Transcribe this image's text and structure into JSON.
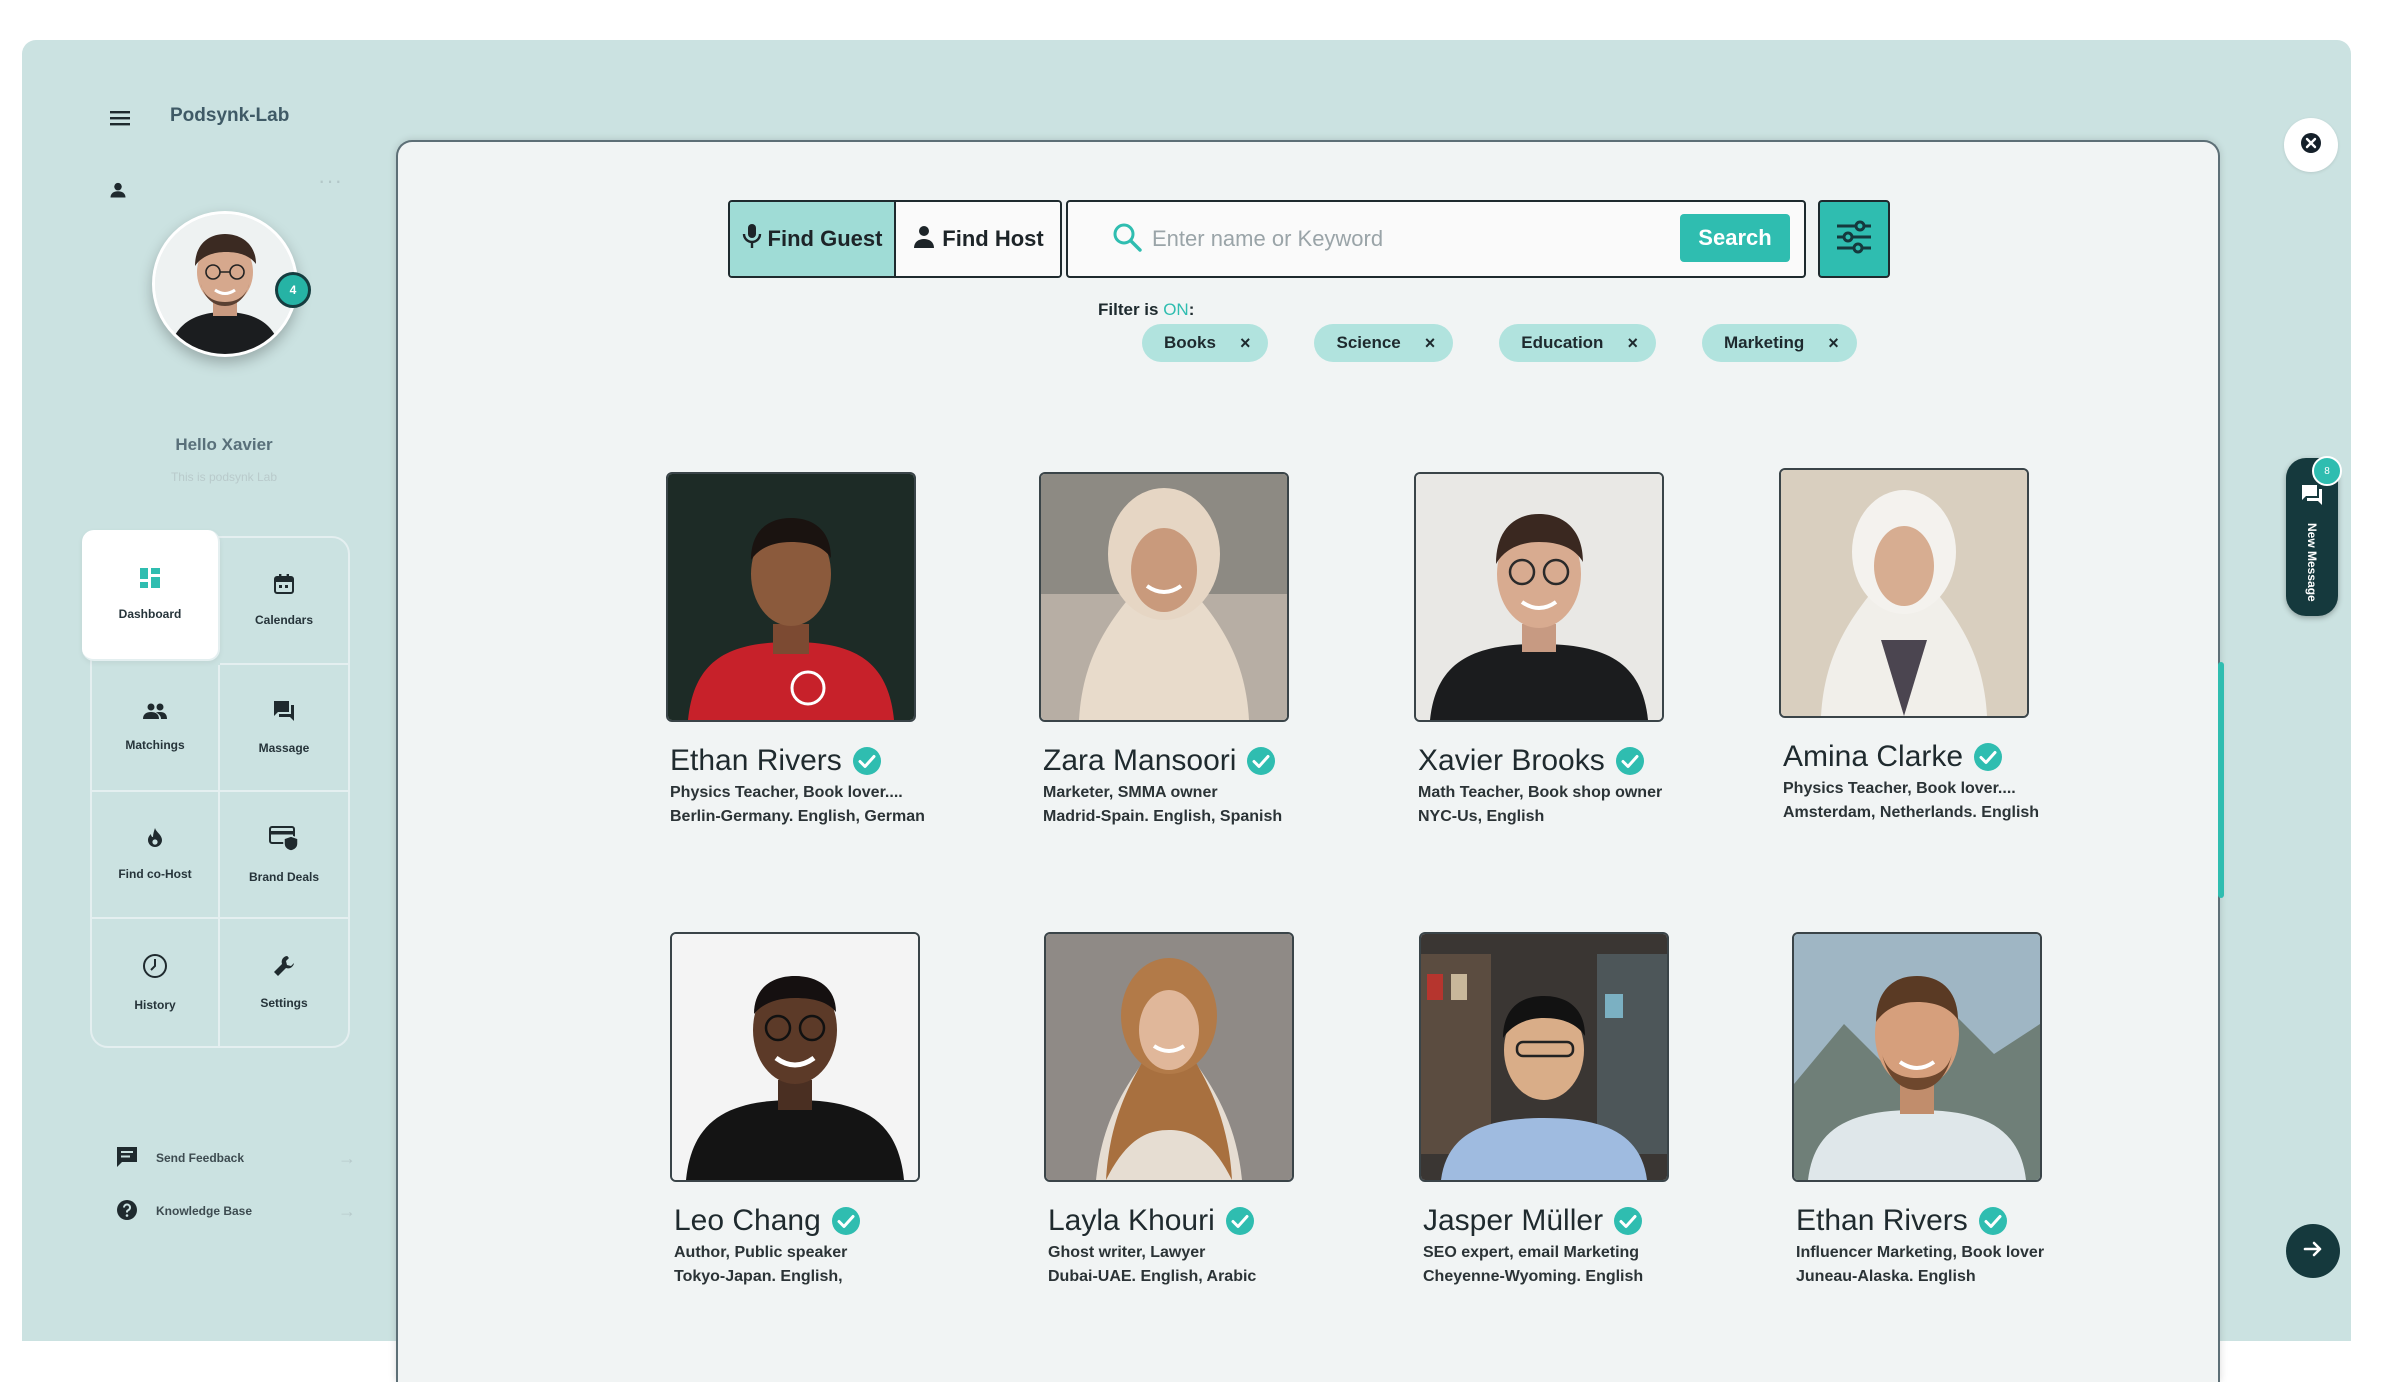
{
  "app": {
    "title": "Podsynk-Lab"
  },
  "profile": {
    "greeting": "Hello Xavier",
    "subtitle": "This is podsynk Lab",
    "badge": "4",
    "menu_dots": "···"
  },
  "nav": [
    {
      "label": "Dashboard",
      "icon": "dashboard-icon",
      "active": true
    },
    {
      "label": "Calendars",
      "icon": "calendar-icon"
    },
    {
      "label": "Matchings",
      "icon": "people-icon"
    },
    {
      "label": "Massage",
      "icon": "chat-icon"
    },
    {
      "label": "Find co-Host",
      "icon": "flame-icon"
    },
    {
      "label": "Brand Deals",
      "icon": "card-shield-icon"
    },
    {
      "label": "History",
      "icon": "clock-icon"
    },
    {
      "label": "Settings",
      "icon": "wrench-icon"
    }
  ],
  "footer": {
    "feedback": "Send Feedback",
    "knowledge": "Knowledge  Base",
    "arrow": "→"
  },
  "search": {
    "find_guest": "Find Guest",
    "find_host": "Find Host",
    "placeholder": "Enter name or Keyword",
    "button": "Search"
  },
  "filter": {
    "label": "Filter is",
    "state": "ON",
    "colon": ":",
    "chips": [
      "Books",
      "Science",
      "Education",
      "Marketing"
    ],
    "remove": "×"
  },
  "guests": [
    {
      "name": "Ethan Rivers",
      "line1": "Physics Teacher, Book lover....",
      "line2": "Berlin-Germany. English, German"
    },
    {
      "name": "Zara Mansoori",
      "line1": "Marketer, SMMA owner",
      "line2": "Madrid-Spain. English, Spanish"
    },
    {
      "name": "Xavier Brooks",
      "line1": "Math Teacher, Book shop owner",
      "line2": "NYC-Us, English"
    },
    {
      "name": "Amina Clarke",
      "line1": "Physics Teacher, Book lover....",
      "line2": " Amsterdam, Netherlands. English"
    },
    {
      "name": "Leo Chang",
      "line1": "Author, Public speaker",
      "line2": "Tokyo-Japan. English,"
    },
    {
      "name": "Layla Khouri",
      "line1": "Ghost writer, Lawyer",
      "line2": "Dubai-UAE. English, Arabic"
    },
    {
      "name": "Jasper Müller",
      "line1": "SEO expert, email Marketing",
      "line2": "Cheyenne-Wyoming. English"
    },
    {
      "name": "Ethan Rivers",
      "line1": "Influencer Marketing, Book lover",
      "line2": "Juneau-Alaska. English"
    }
  ],
  "messages": {
    "label": "New Message",
    "badge": "8"
  },
  "colors": {
    "accent": "#2fbdb0",
    "app_bg": "#cbe2e1",
    "dark": "#15393d"
  }
}
